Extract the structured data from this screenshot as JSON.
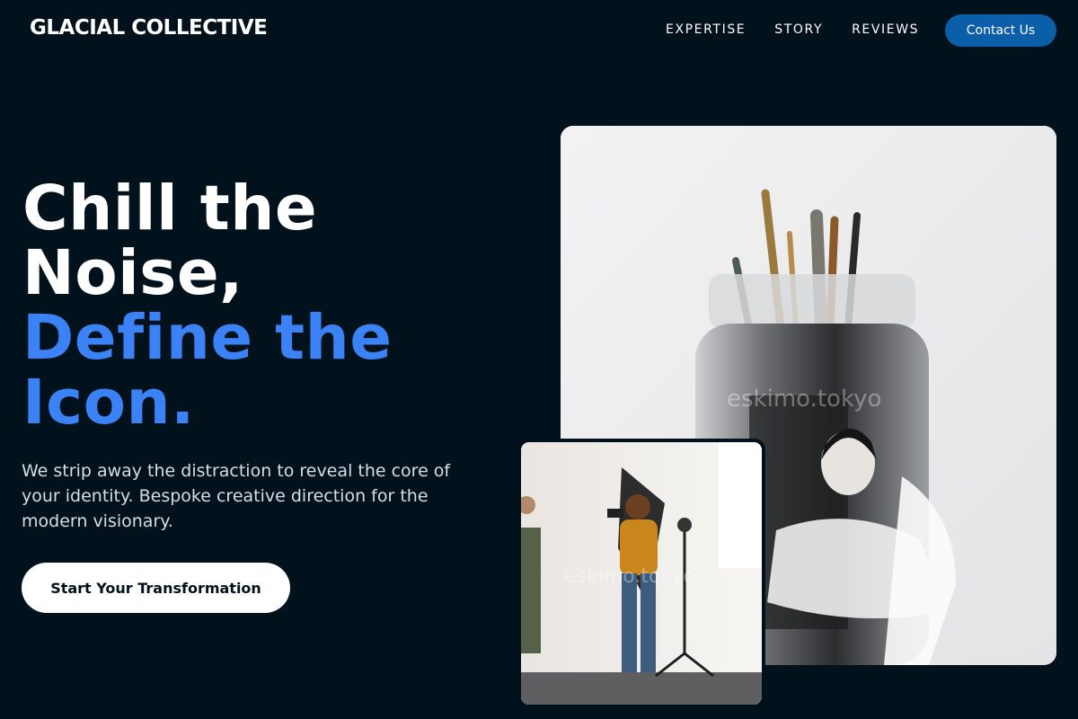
{
  "brand": {
    "name": "GLACIAL COLLECTIVE"
  },
  "nav": {
    "links": [
      "EXPERTISE",
      "STORY",
      "REVIEWS"
    ],
    "contact_label": "Contact Us"
  },
  "hero": {
    "headline_line1": "Chill the",
    "headline_line2": "Noise,",
    "headline_line3": "Define the",
    "headline_line4": "Icon.",
    "subtext": "We strip away the distraction to reveal the core of your identity. Bespoke creative direction for the modern visionary.",
    "cta_label": "Start Your Transformation"
  },
  "images": {
    "main_watermark": "eskimo.tokyo",
    "small_watermark": "eskimo.tokyo"
  },
  "colors": {
    "background": "#02121c",
    "accent_blue": "#3b82f6",
    "button_blue": "#0a5fa8"
  }
}
